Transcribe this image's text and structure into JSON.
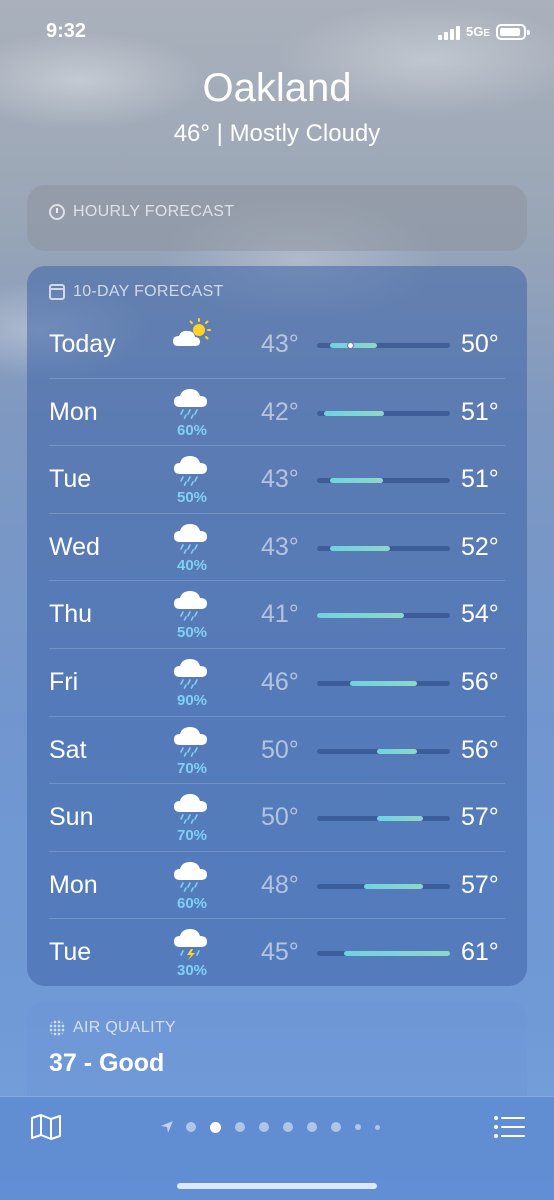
{
  "status_bar": {
    "time": "9:32",
    "network": "5G",
    "network_suffix": "E"
  },
  "header": {
    "city": "Oakland",
    "summary": "46°  |  Mostly Cloudy"
  },
  "hourly": {
    "title": "HOURLY FORECAST",
    "icon": "clock-icon"
  },
  "forecast": {
    "title": "10-DAY FORECAST",
    "icon": "calendar-icon",
    "days": [
      {
        "day": "Today",
        "icon": "partly-sunny-icon",
        "precip": "",
        "low": "43°",
        "high": "50°",
        "low_val": 43,
        "high_val": 50,
        "current": 46
      },
      {
        "day": "Mon",
        "icon": "rain-icon",
        "precip": "60%",
        "low": "42°",
        "high": "51°",
        "low_val": 42,
        "high_val": 51
      },
      {
        "day": "Tue",
        "icon": "rain-icon",
        "precip": "50%",
        "low": "43°",
        "high": "51°",
        "low_val": 43,
        "high_val": 51
      },
      {
        "day": "Wed",
        "icon": "rain-icon",
        "precip": "40%",
        "low": "43°",
        "high": "52°",
        "low_val": 43,
        "high_val": 52
      },
      {
        "day": "Thu",
        "icon": "rain-icon",
        "precip": "50%",
        "low": "41°",
        "high": "54°",
        "low_val": 41,
        "high_val": 54
      },
      {
        "day": "Fri",
        "icon": "rain-icon",
        "precip": "90%",
        "low": "46°",
        "high": "56°",
        "low_val": 46,
        "high_val": 56
      },
      {
        "day": "Sat",
        "icon": "rain-icon",
        "precip": "70%",
        "low": "50°",
        "high": "56°",
        "low_val": 50,
        "high_val": 56
      },
      {
        "day": "Sun",
        "icon": "rain-icon",
        "precip": "70%",
        "low": "50°",
        "high": "57°",
        "low_val": 50,
        "high_val": 57
      },
      {
        "day": "Mon",
        "icon": "rain-icon",
        "precip": "60%",
        "low": "48°",
        "high": "57°",
        "low_val": 48,
        "high_val": 57
      },
      {
        "day": "Tue",
        "icon": "thunderstorm-icon",
        "precip": "30%",
        "low": "45°",
        "high": "61°",
        "low_val": 45,
        "high_val": 61
      }
    ]
  },
  "air_quality": {
    "title": "AIR QUALITY",
    "value": "37 - Good",
    "icon": "air-quality-icon"
  },
  "bottom_bar": {
    "map_icon": "map-icon",
    "list_icon": "list-icon",
    "page_count": 8,
    "active_page": 1
  }
}
